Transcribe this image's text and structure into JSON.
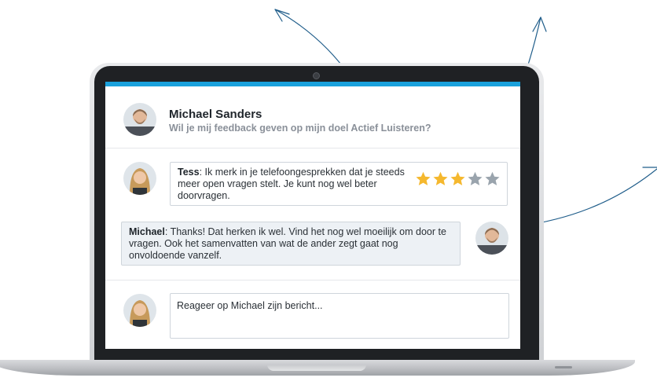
{
  "header": {
    "name": "Michael Sanders",
    "question": "Wil je mij feedback geven op mijn doel Actief Luisteren?"
  },
  "comments": [
    {
      "author": "Tess",
      "text": ": Ik merk in je telefoongesprekken dat je steeds meer open vragen stelt. Je kunt nog wel beter doorvragen.",
      "lines": [
        "Ik merk in je telefoongesprekken dat je steeds",
        "meer open vragen stelt. Je kunt nog wel beter",
        "doorvragen."
      ],
      "rating": 3,
      "rating_max": 5
    },
    {
      "author": "Michael",
      "lines": [
        "Thanks! Dat herken ik wel. Vind het nog wel moeilijk om door te",
        "vragen. Ook het samenvatten van wat de ander zegt gaat nog",
        "onvoldoende vanzelf."
      ]
    }
  ],
  "reply": {
    "placeholder": "Reageer op Michael zijn bericht..."
  },
  "colors": {
    "accent": "#1aa1dc",
    "star_filled": "#f5b82e",
    "star_empty": "#9aa4ad",
    "arrow": "#1f5d8a"
  },
  "icons": {
    "filled_star": "star-filled-icon",
    "empty_star": "star-empty-icon",
    "camera": "camera-icon"
  }
}
